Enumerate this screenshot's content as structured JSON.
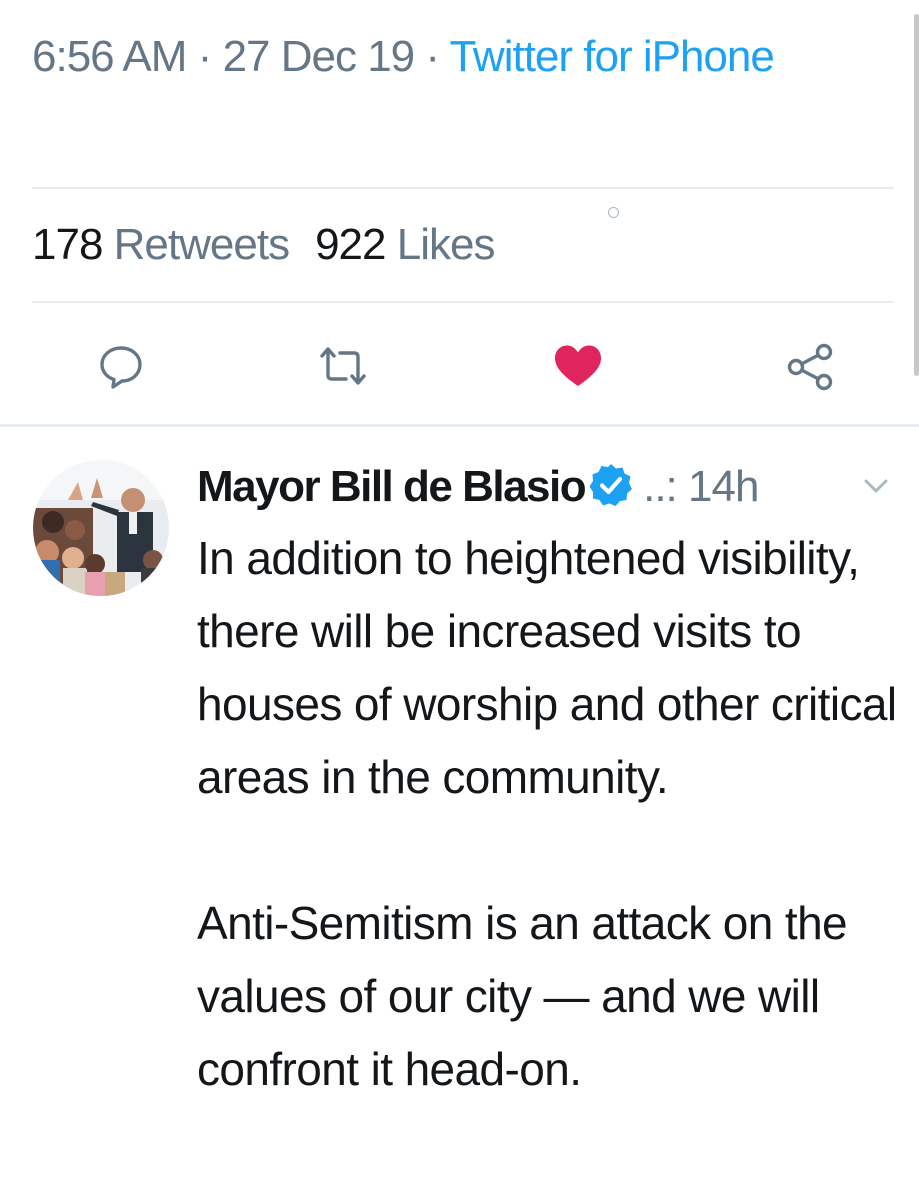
{
  "tweet_detail": {
    "time": "6:56 AM",
    "separator": "·",
    "date": "27 Dec 19",
    "source": "Twitter for iPhone",
    "stats": {
      "retweets_count": "178",
      "retweets_label": "Retweets",
      "likes_count": "922",
      "likes_label": "Likes"
    },
    "actions": [
      {
        "name": "reply",
        "icon": "reply-icon"
      },
      {
        "name": "retweet",
        "icon": "retweet-icon"
      },
      {
        "name": "like",
        "icon": "heart-icon",
        "active": true,
        "color": "#e0245e"
      },
      {
        "name": "share",
        "icon": "share-icon"
      }
    ]
  },
  "reply_tweet": {
    "author_name": "Mayor Bill de Blasio",
    "verified": true,
    "handle": "..:",
    "time_ago": "14h",
    "text_paragraph_1": "In addition to heightened visibility, there will be increased visits to houses of worship and other critical areas in the community.",
    "text_paragraph_2": "Anti-Semitism is an attack on the values of our city — and we will confront it head-on."
  },
  "colors": {
    "accent": "#1da1f2",
    "secondary_text": "#657786",
    "primary_text": "#14171a",
    "like_active": "#e0245e",
    "divider": "#e6ecf0"
  }
}
